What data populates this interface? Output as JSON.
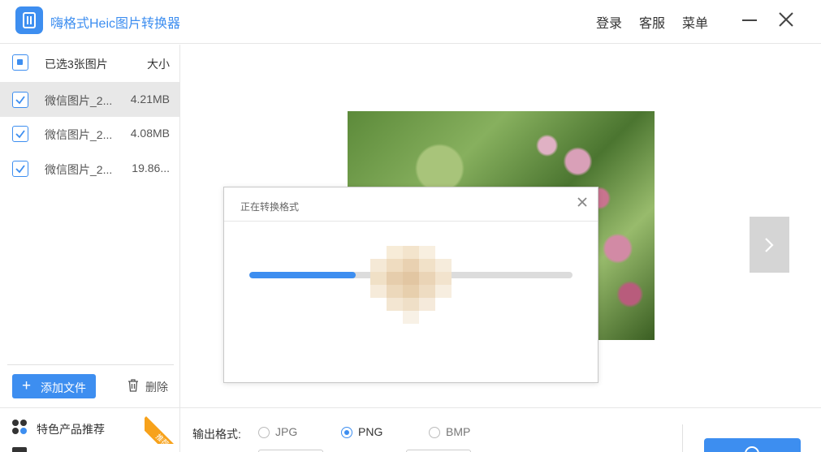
{
  "app": {
    "title": "嗨格式Heic图片转换器"
  },
  "header": {
    "login": "登录",
    "service": "客服",
    "menu": "菜单"
  },
  "file_list": {
    "header_label": "已选3张图片",
    "size_header": "大小",
    "files": [
      {
        "name": "微信图片_2...",
        "size": "4.21MB",
        "checked": true,
        "selected": true
      },
      {
        "name": "微信图片_2...",
        "size": "4.08MB",
        "checked": true,
        "selected": false
      },
      {
        "name": "微信图片_2...",
        "size": "19.86...",
        "checked": true,
        "selected": false
      }
    ],
    "add_button": "添加文件",
    "delete_button": "删除"
  },
  "dialog": {
    "title": "正在转换格式",
    "progress": 0.33
  },
  "promo": {
    "label": "特色产品推荐",
    "badge": "推荐"
  },
  "output": {
    "label": "输出格式:",
    "options": [
      "JPG",
      "PNG",
      "BMP"
    ],
    "selected": "PNG"
  },
  "colors": {
    "accent": "#3d8ef0",
    "badge": "#f7a21b"
  }
}
